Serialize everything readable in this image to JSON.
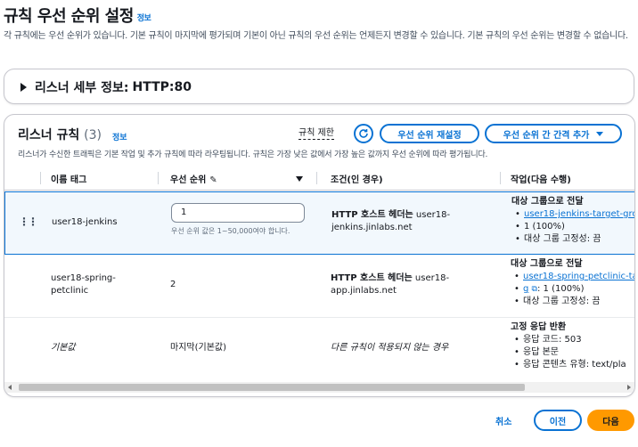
{
  "page": {
    "title": "규칙 우선 순위 설정",
    "info": "정보",
    "description": "각 규칙에는 우선 순위가 있습니다. 기본 규칙이 마지막에 평가되며 기본이 아닌 규칙의 우선 순위는 언제든지 변경할 수 있습니다. 기본 규칙의 우선 순위는 변경할 수 없습니다."
  },
  "listener_details": {
    "label": "리스너 세부 정보:",
    "value": "HTTP:80"
  },
  "rules": {
    "title": "리스너 규칙",
    "count": "(3)",
    "info": "정보",
    "limit_link": "규칙 제한",
    "refresh_icon": "refresh-icon",
    "reset_button": "우선 순위 재설정",
    "add_button": "우선 순위 간 간격 추가",
    "description": "리스너가 수신한 트래픽은 기본 작업 및 추가 규칙에 따라 라우팅됩니다. 규칙은 가장 낮은 값에서 가장 높은 값까지 우선 순위에 따라 평가됩니다.",
    "columns": {
      "name": "이름 태그",
      "priority": "우선 순위",
      "conditions": "조건(인 경우)",
      "actions": "작업(다음 수행)"
    },
    "rows": [
      {
        "name": "user18-jenkins",
        "priority": "1",
        "priority_hint": "우선 순위 값은 1~50,000여야 합니다.",
        "cond_label": "HTTP 호스트 헤더는",
        "cond_value_1": "user18-",
        "cond_value_2": "jenkins.jinlabs.net",
        "action_title": "대상 그룹으로 전달",
        "target": "user18-jenkins-target-gro",
        "target_weight": "1 (100%)",
        "stickiness": "대상 그룹 고정성: 끔"
      },
      {
        "name_1": "user18-spring-",
        "name_2": "petclinic",
        "priority": "2",
        "cond_label": "HTTP 호스트 헤더는",
        "cond_value_1": "user18-",
        "cond_value_2": "app.jinlabs.net",
        "action_title": "대상 그룹으로 전달",
        "target_1": "user18-spring-petclinic-ta",
        "target_2": "g",
        "target_weight": ": 1 (100%)",
        "stickiness": "대상 그룹 고정성: 끔"
      },
      {
        "name": "기본값",
        "priority": "마지막(기본값)",
        "condition": "다른 규칙이 적용되지 않는 경우",
        "action_title": "고정 응답 반환",
        "code": "응답 코드: 503",
        "body": "응답 본문",
        "content_type": "응답 콘텐츠 유형: text/pla"
      }
    ]
  },
  "footer": {
    "cancel": "취소",
    "prev": "이전",
    "next": "다음"
  },
  "colors": {
    "accent": "#0972d3",
    "primary_button": "#ff9900",
    "selected_row_bg": "#f2f8fd"
  }
}
